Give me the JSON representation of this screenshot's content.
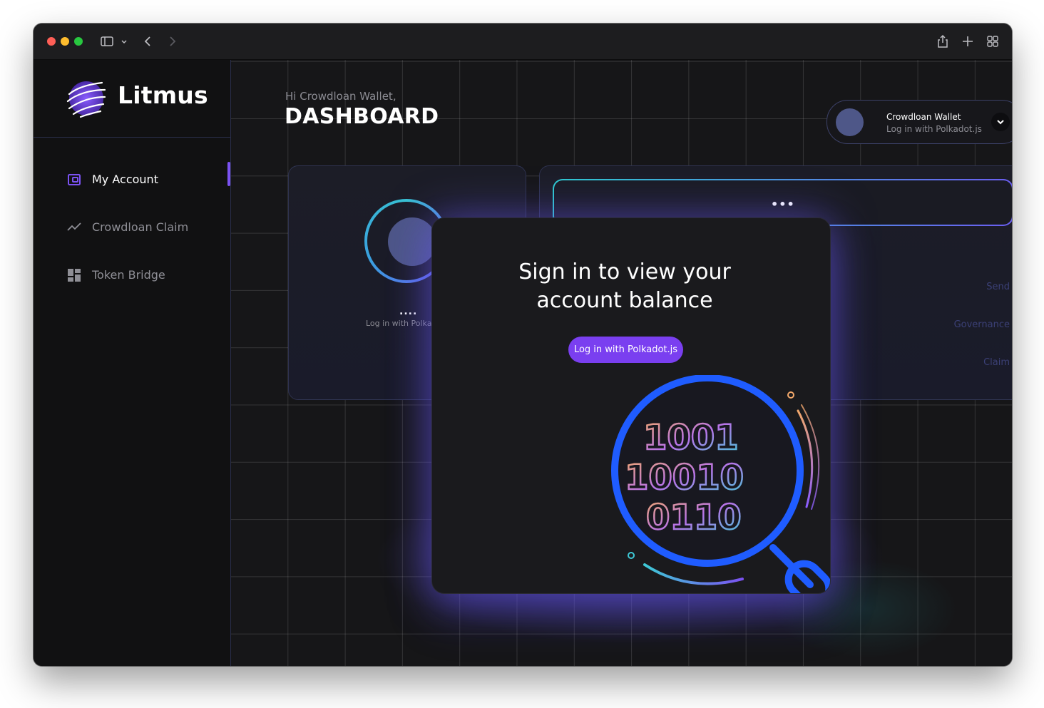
{
  "app": {
    "name": "Litmus",
    "colors": {
      "accent": "#7a3ff0",
      "indicator": "#7b52f2",
      "cyan": "#2ec9cf",
      "blue": "#1f5cff"
    }
  },
  "browser": {
    "icons": [
      "sidebar-toggle-icon",
      "chevron-down-icon",
      "back-icon",
      "forward-icon",
      "share-icon",
      "new-tab-icon",
      "tab-overview-icon"
    ]
  },
  "sidebar": {
    "items": [
      {
        "label": "My Account",
        "icon": "wallet-icon",
        "active": true
      },
      {
        "label": "Crowdloan Claim",
        "icon": "chart-line-icon",
        "active": false
      },
      {
        "label": "Token Bridge",
        "icon": "dashboard-grid-icon",
        "active": false
      }
    ]
  },
  "header": {
    "greeting": "Hi Crowdloan Wallet,",
    "title": "DASHBOARD"
  },
  "wallet": {
    "name": "Crowdloan Wallet",
    "subtitle": "Log in with Polkadot.js"
  },
  "account_card": {
    "placeholder": "....",
    "subtitle": "Log in with Polkadot.js"
  },
  "balance_card": {
    "placeholder": "•••",
    "actions": [
      "Send",
      "Governance",
      "Claim"
    ]
  },
  "modal": {
    "title_line1": "Sign in to view your",
    "title_line2": "account balance",
    "button": "Log in with Polkadot.js",
    "binary_rows": [
      "1001",
      "10010",
      "0110"
    ]
  }
}
